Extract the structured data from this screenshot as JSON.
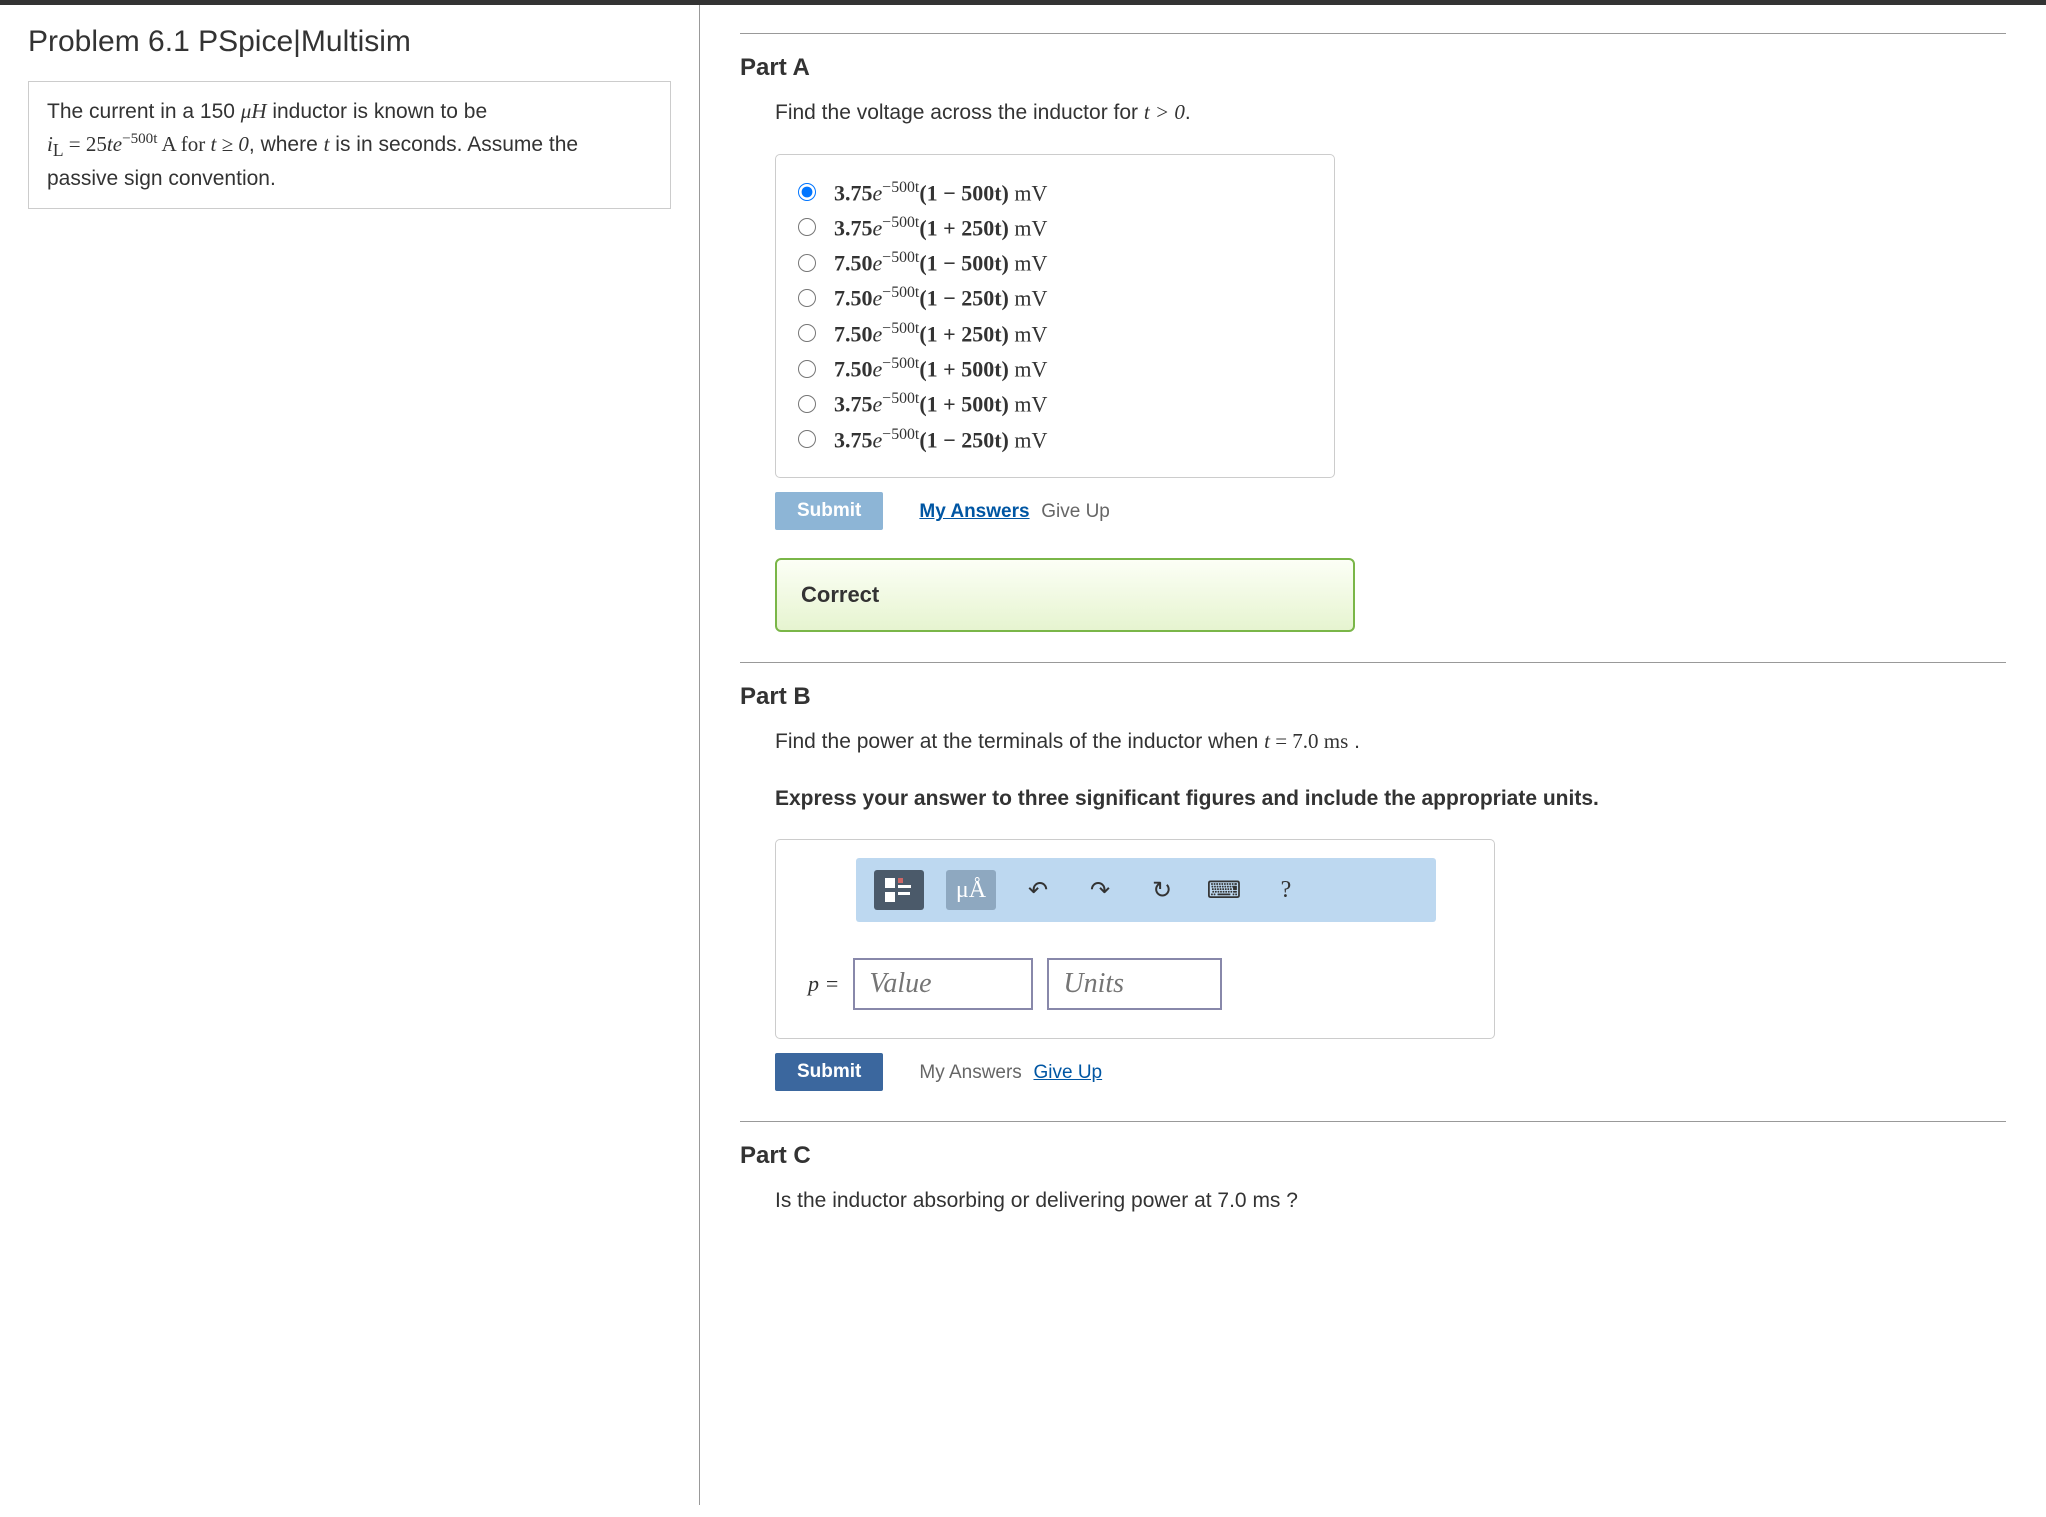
{
  "problem": {
    "title": "Problem 6.1 PSpice|Multisim",
    "description_pre": "The current in a 150 ",
    "description_unit": "μH",
    "description_post1": " inductor is known to be",
    "eq_lhs": "i",
    "eq_sub": "L",
    "eq_eq": " = ",
    "eq_coef": "25",
    "eq_te": "te",
    "eq_exp": "−500t",
    "eq_unit": " A for ",
    "eq_cond": "t ≥ 0",
    "description_post2": ", where ",
    "eq_tvar": "t",
    "description_post3": " is in seconds. Assume the passive sign convention."
  },
  "partA": {
    "title": "Part A",
    "prompt_pre": "Find the voltage across the inductor for ",
    "prompt_math": "t > 0",
    "prompt_post": ".",
    "options": [
      {
        "selected": true,
        "coef": "3.75",
        "exp": "−500t",
        "inner": "(1 − 500t)",
        "unit": " mV"
      },
      {
        "selected": false,
        "coef": "3.75",
        "exp": "−500t",
        "inner": "(1 + 250t)",
        "unit": " mV"
      },
      {
        "selected": false,
        "coef": "7.50",
        "exp": "−500t",
        "inner": "(1 − 500t)",
        "unit": " mV"
      },
      {
        "selected": false,
        "coef": "7.50",
        "exp": "−500t",
        "inner": "(1 − 250t)",
        "unit": " mV"
      },
      {
        "selected": false,
        "coef": "7.50",
        "exp": "−500t",
        "inner": "(1 + 250t)",
        "unit": " mV"
      },
      {
        "selected": false,
        "coef": "7.50",
        "exp": "−500t",
        "inner": "(1 + 500t)",
        "unit": " mV"
      },
      {
        "selected": false,
        "coef": "3.75",
        "exp": "−500t",
        "inner": "(1 + 500t)",
        "unit": " mV"
      },
      {
        "selected": false,
        "coef": "3.75",
        "exp": "−500t",
        "inner": "(1 − 250t)",
        "unit": " mV"
      }
    ],
    "submit": "Submit",
    "my_answers": "My Answers",
    "give_up": "Give Up",
    "feedback": "Correct"
  },
  "partB": {
    "title": "Part B",
    "prompt_pre": "Find the power at the terminals of the inductor when ",
    "prompt_math": "t",
    "prompt_eq": " = 7.0  ms",
    "prompt_post": " .",
    "prompt2": "Express your answer to three significant figures and include the appropriate units.",
    "toolbar": {
      "templates_icon": "templates-icon",
      "units_label": "μÅ",
      "undo_icon": "↶",
      "redo_icon": "↷",
      "reset_icon": "↻",
      "keyboard_icon": "⌨",
      "help_icon": "?"
    },
    "eq_label": "p =",
    "value_placeholder": "Value",
    "units_placeholder": "Units",
    "submit": "Submit",
    "my_answers": "My Answers",
    "give_up": "Give Up"
  },
  "partC": {
    "title": "Part C",
    "prompt": "Is the inductor absorbing or delivering power at 7.0  ms ?"
  }
}
